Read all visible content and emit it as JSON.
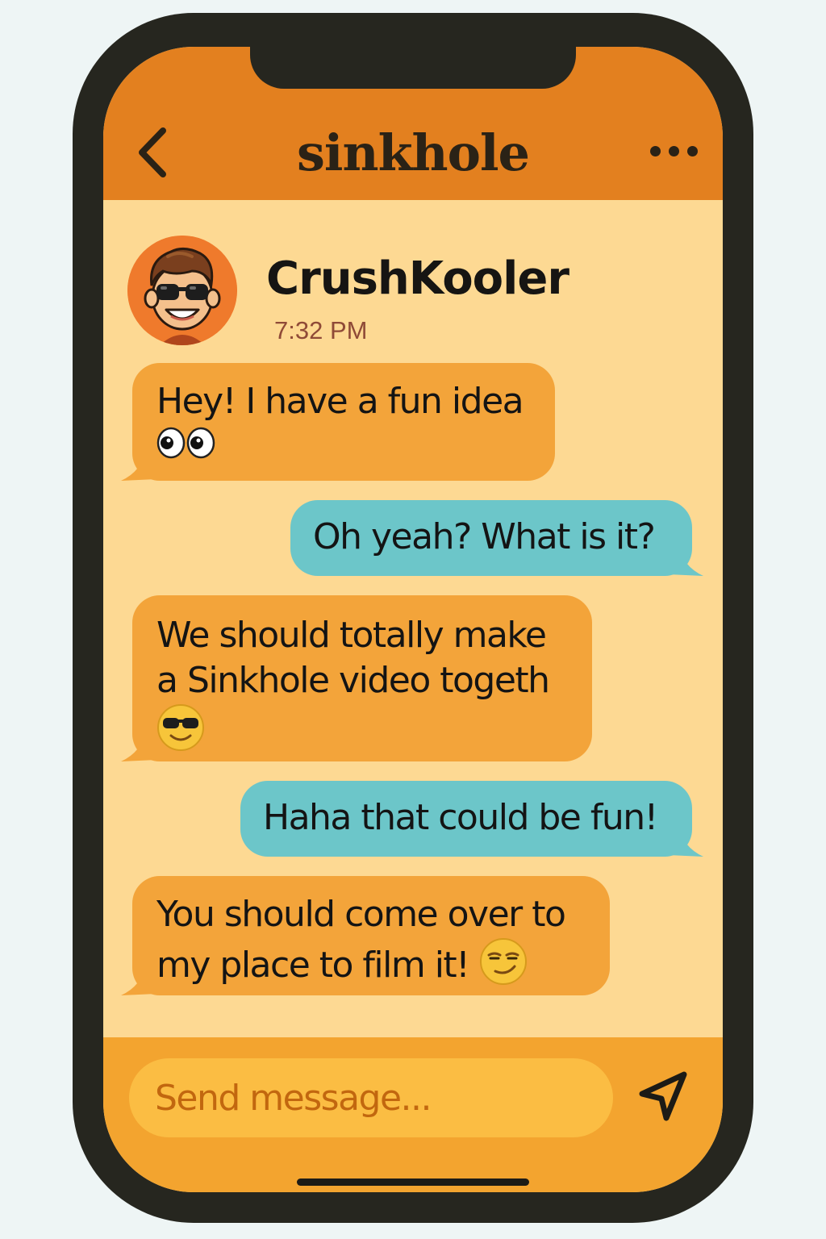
{
  "header": {
    "app_title": "sinkhole",
    "back_icon": "chevron-left-icon",
    "more_icon": "more-horizontal-icon"
  },
  "contact": {
    "name": "CrushKooler",
    "time": "7:32 PM",
    "avatar": "cartoon-avatar-sunglasses"
  },
  "messages": [
    {
      "direction": "incoming",
      "text": "Hey! I have a fun idea",
      "emoji": "eyes"
    },
    {
      "direction": "outgoing",
      "text": "Oh yeah? What is it?"
    },
    {
      "direction": "incoming",
      "text": "We should totally make\na Sinkhole video togeth",
      "emoji": "smiling-face-with-sunglasses"
    },
    {
      "direction": "outgoing",
      "text": "Haha that could be fun!"
    },
    {
      "direction": "incoming",
      "text": "You should come over to\nmy place to film it!",
      "emoji": "smirking-face"
    }
  ],
  "composer": {
    "placeholder": "Send message...",
    "value": "",
    "send_icon": "send-icon"
  },
  "colors": {
    "header": "#e3801f",
    "chat_background": "#fdd993",
    "incoming_bubble": "#f3a43a",
    "outgoing_bubble": "#6cc6c9",
    "composer_bar": "#f3a42f",
    "input_field": "#fbbd43",
    "placeholder": "#c2670f",
    "timestamp": "#8f4a37",
    "phone_frame": "#26261f"
  }
}
